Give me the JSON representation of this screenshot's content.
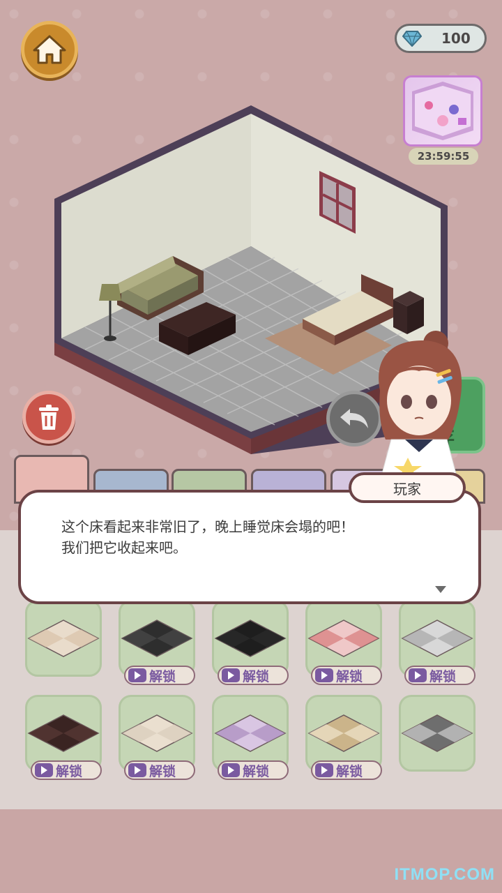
{
  "currency": {
    "gem_count": "100",
    "gem_icon": "diamond-icon"
  },
  "gift": {
    "timer": "23:59:55"
  },
  "buttons": {
    "save_label": "存"
  },
  "dialog": {
    "speaker": "玩家",
    "text": "这个床看起来非常旧了，晚上睡觉床会塌的吧！\n我们把它收起来吧。"
  },
  "items": {
    "unlock_label": "解锁",
    "row1": [
      {
        "pattern": "tan-star-tile",
        "locked": false
      },
      {
        "pattern": "black-plank",
        "locked": true
      },
      {
        "pattern": "black-solid",
        "locked": true
      },
      {
        "pattern": "pink-flower",
        "locked": true
      },
      {
        "pattern": "grey-checker",
        "locked": true
      }
    ],
    "row2": [
      {
        "pattern": "dark-wood",
        "locked": true
      },
      {
        "pattern": "beige-plain",
        "locked": true
      },
      {
        "pattern": "lavender-weave",
        "locked": true
      },
      {
        "pattern": "tan-checker",
        "locked": true
      },
      {
        "pattern": "dark-grey-checker",
        "locked": false
      }
    ]
  },
  "watermark": "ITMOP.COM"
}
